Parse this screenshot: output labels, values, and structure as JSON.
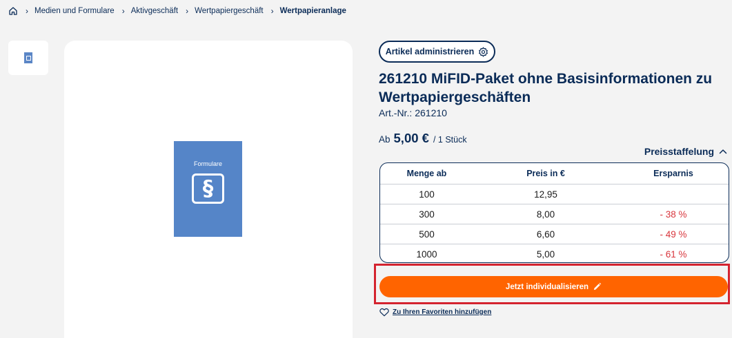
{
  "breadcrumb": {
    "home_icon": "home-icon",
    "items": [
      "Medien und Formulare",
      "Aktivgeschäft",
      "Wertpapiergeschäft",
      "Wertpapieranlage"
    ]
  },
  "gallery": {
    "cover_title": "Formulare",
    "cover_symbol": "§"
  },
  "admin_button": {
    "label": "Artikel administrieren",
    "icon": "gear-icon"
  },
  "product": {
    "title": "261210 MiFID-Paket ohne Basisinformationen zu Wertpapiergeschäften",
    "art_nr_label": "Art.-Nr.:",
    "art_nr": "261210"
  },
  "price": {
    "prefix": "Ab",
    "value": "5,00 €",
    "unit": "/ 1 Stück"
  },
  "tiers": {
    "toggle_label": "Preisstaffelung",
    "toggle_icon": "chevron-up-icon",
    "headers": [
      "Menge ab",
      "Preis in €",
      "Ersparnis"
    ],
    "rows": [
      {
        "qty": "100",
        "price": "12,95",
        "saving": ""
      },
      {
        "qty": "300",
        "price": "8,00",
        "saving": "- 38 %"
      },
      {
        "qty": "500",
        "price": "6,60",
        "saving": "- 49 %"
      },
      {
        "qty": "1000",
        "price": "5,00",
        "saving": "- 61 %"
      }
    ]
  },
  "cta": {
    "label": "Jetzt individualisieren",
    "icon": "pencil-icon"
  },
  "favorite": {
    "label": "Zu Ihren Favoriten hinzufügen",
    "icon": "heart-icon"
  },
  "colors": {
    "navy": "#0a2b57",
    "accent_orange": "#ff6400",
    "saving_red": "#d8353c",
    "highlight_red": "#d4232f",
    "cover_blue": "#5585c8"
  }
}
